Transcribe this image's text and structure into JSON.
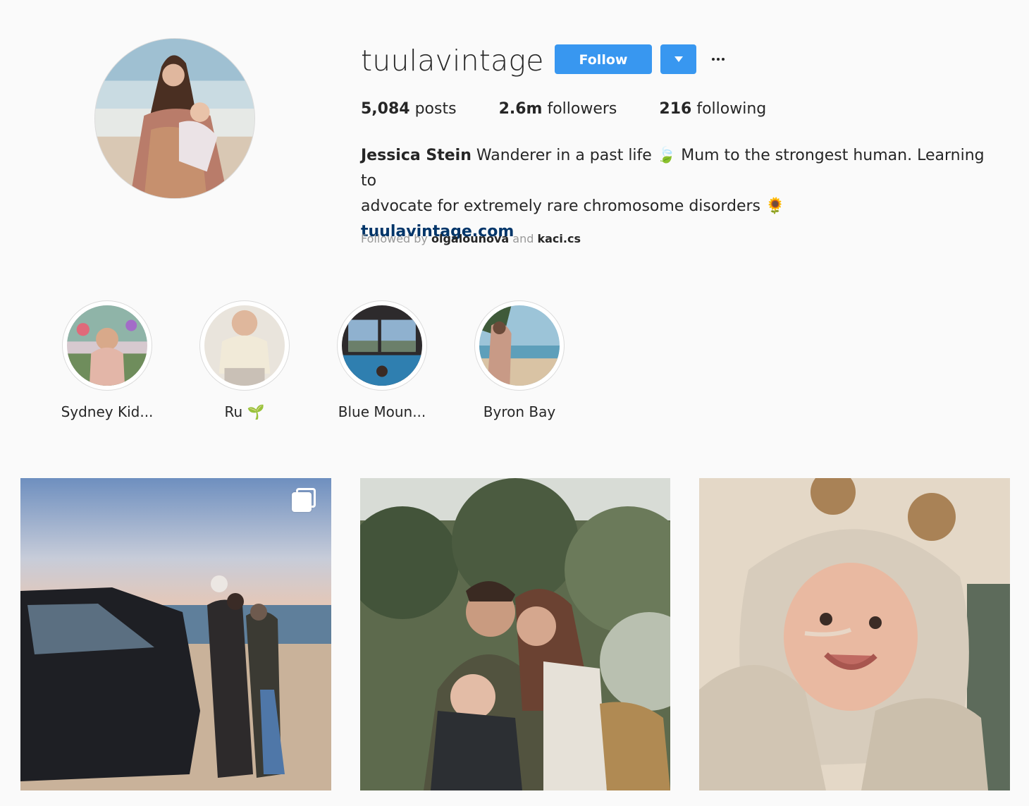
{
  "profile": {
    "username": "tuulavintage",
    "follow_label": "Follow",
    "stats": {
      "posts_count": "5,084",
      "posts_label": " posts",
      "followers_count": "2.6m",
      "followers_label": " followers",
      "following_count": "216",
      "following_label": " following"
    },
    "bio": {
      "full_name": "Jessica Stein",
      "text_line1": " Wanderer in a past life 🍃 Mum to the strongest human. Learning to",
      "text_line2": "advocate for extremely rare chromosome disorders 🌻",
      "website": "tuulavintage.com"
    },
    "followed_by": {
      "prefix": "Followed by ",
      "user1": "olgalounova",
      "joiner": " and ",
      "user2": "kaci.cs"
    }
  },
  "highlights": [
    {
      "label": "Sydney Kid..."
    },
    {
      "label": "Ru 🌱"
    },
    {
      "label": "Blue Moun..."
    },
    {
      "label": "Byron Bay"
    }
  ],
  "icons": {
    "dropdown": "caret-down-icon",
    "more": "ellipsis-icon",
    "multi_post": "multiple-images-icon"
  },
  "colors": {
    "accent": "#3897f0",
    "link": "#003569",
    "background": "#fafafa"
  }
}
